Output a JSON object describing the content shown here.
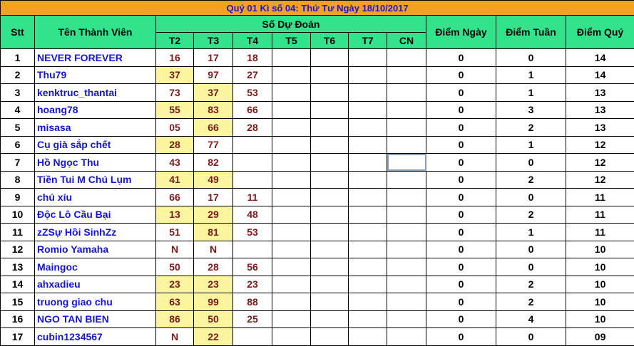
{
  "title": "Quý 01 Kì số 04: Thứ Tư Ngày 18/10/2017",
  "headers": {
    "stt": "Stt",
    "name": "Tên Thành Viên",
    "group": "Số Dự Đoán",
    "days": [
      "T2",
      "T3",
      "T4",
      "T5",
      "T6",
      "T7",
      "CN"
    ],
    "diem_ngay": "Điểm Ngày",
    "diem_tuan": "Điểm Tuần",
    "diem_quy": "Điểm Quý"
  },
  "rows": [
    {
      "stt": "1",
      "name": "NEVER FOREVER",
      "t2": "16",
      "t3": "17",
      "t4": "18",
      "hl2": false,
      "hl3": false,
      "ngay": "0",
      "tuan": "0",
      "quy": "14"
    },
    {
      "stt": "2",
      "name": "Thu79",
      "t2": "37",
      "t3": "97",
      "t4": "27",
      "hl2": true,
      "hl3": false,
      "ngay": "0",
      "tuan": "1",
      "quy": "14"
    },
    {
      "stt": "3",
      "name": "kenktruc_thantai",
      "t2": "73",
      "t3": "37",
      "t4": "53",
      "hl2": false,
      "hl3": true,
      "ngay": "0",
      "tuan": "1",
      "quy": "13"
    },
    {
      "stt": "4",
      "name": "hoang78",
      "t2": "55",
      "t3": "83",
      "t4": "66",
      "hl2": true,
      "hl3": true,
      "ngay": "0",
      "tuan": "3",
      "quy": "13"
    },
    {
      "stt": "5",
      "name": "misasa",
      "t2": "05",
      "t3": "66",
      "t4": "28",
      "hl2": false,
      "hl3": true,
      "ngay": "0",
      "tuan": "2",
      "quy": "13"
    },
    {
      "stt": "6",
      "name": "Cụ già sắp chết",
      "t2": "28",
      "t3": "77",
      "t4": "",
      "hl2": true,
      "hl3": false,
      "ngay": "0",
      "tuan": "1",
      "quy": "12"
    },
    {
      "stt": "7",
      "name": "Hồ Ngọc Thu",
      "t2": "43",
      "t3": "82",
      "t4": "",
      "hl2": false,
      "hl3": false,
      "ngay": "0",
      "tuan": "0",
      "quy": "12"
    },
    {
      "stt": "8",
      "name": "Tiền Tui M Chú Lụm",
      "t2": "41",
      "t3": "49",
      "t4": "",
      "hl2": true,
      "hl3": true,
      "ngay": "0",
      "tuan": "2",
      "quy": "12"
    },
    {
      "stt": "9",
      "name": "chú xíu",
      "t2": "66",
      "t3": "17",
      "t4": "11",
      "hl2": false,
      "hl3": false,
      "ngay": "0",
      "tuan": "0",
      "quy": "11"
    },
    {
      "stt": "10",
      "name": "Độc Lô Cầu Bại",
      "t2": "13",
      "t3": "29",
      "t4": "48",
      "hl2": true,
      "hl3": true,
      "ngay": "0",
      "tuan": "2",
      "quy": "11"
    },
    {
      "stt": "11",
      "name": "zZSự Hồi SinhZz",
      "t2": "51",
      "t3": "81",
      "t4": "53",
      "hl2": false,
      "hl3": true,
      "ngay": "0",
      "tuan": "1",
      "quy": "11"
    },
    {
      "stt": "12",
      "name": "Romio Yamaha",
      "t2": "N",
      "t3": "N",
      "t4": "",
      "hl2": false,
      "hl3": false,
      "ngay": "0",
      "tuan": "0",
      "quy": "10"
    },
    {
      "stt": "13",
      "name": "Maingoc",
      "t2": "50",
      "t3": "28",
      "t4": "56",
      "hl2": false,
      "hl3": false,
      "ngay": "0",
      "tuan": "0",
      "quy": "10"
    },
    {
      "stt": "14",
      "name": "ahxadieu",
      "t2": "23",
      "t3": "23",
      "t4": "23",
      "hl2": true,
      "hl3": true,
      "ngay": "0",
      "tuan": "2",
      "quy": "10"
    },
    {
      "stt": "15",
      "name": "truong giao chu",
      "t2": "63",
      "t3": "99",
      "t4": "88",
      "hl2": true,
      "hl3": true,
      "ngay": "0",
      "tuan": "2",
      "quy": "10"
    },
    {
      "stt": "16",
      "name": "NGO TAN BIEN",
      "t2": "86",
      "t3": "50",
      "t4": "25",
      "hl2": true,
      "hl3": true,
      "ngay": "0",
      "tuan": "4",
      "quy": "10"
    },
    {
      "stt": "17",
      "name": "cubin1234567",
      "t2": "N",
      "t3": "22",
      "t4": "",
      "hl2": false,
      "hl3": true,
      "ngay": "0",
      "tuan": "0",
      "quy": "09"
    }
  ],
  "colors": {
    "title_bg": "#f5a11f",
    "title_text": "#1515e6",
    "header_bg": "#33e38c",
    "highlight_cell": "#fcf5a0",
    "name_text": "#1414d6",
    "prediction_text": "#7a1a1a"
  }
}
